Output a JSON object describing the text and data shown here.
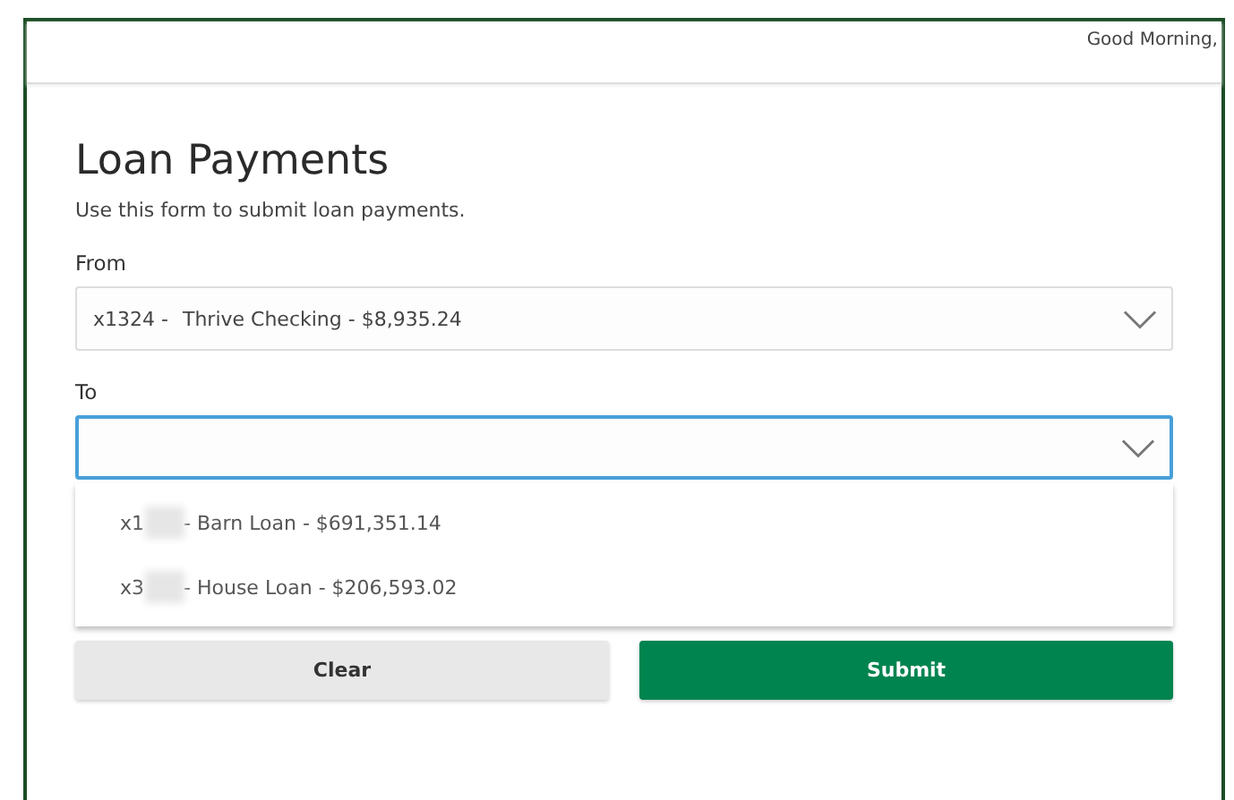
{
  "header": {
    "greeting": "Good Morning,"
  },
  "title": "Loan Payments",
  "subtitle": "Use this form to submit loan payments.",
  "from": {
    "label": "From",
    "value_prefix": "x1324 -",
    "value": "Thrive Checking - $8,935.24"
  },
  "to": {
    "label": "To",
    "focused": true,
    "expanded": true,
    "options": [
      {
        "prefix": "x1",
        "text": "- Barn Loan - $691,351.14",
        "redacted": true
      },
      {
        "prefix": "x3",
        "text": "- House Loan - $206,593.02",
        "redacted": true
      }
    ]
  },
  "buttons": [
    {
      "label": "Clear",
      "kind": "secondary"
    },
    {
      "label": "Submit",
      "kind": "primary"
    }
  ]
}
